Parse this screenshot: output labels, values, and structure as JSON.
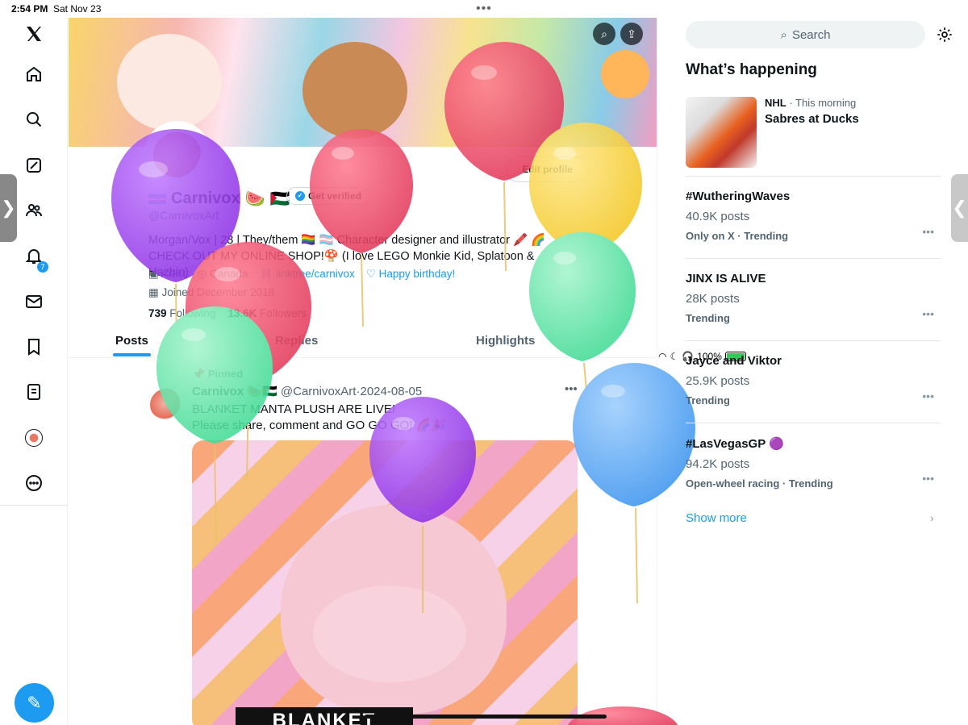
{
  "status": {
    "time": "2:54 PM",
    "date": "Sat Nov 23",
    "battery": "100%"
  },
  "nav": {
    "notifications_badge": "7"
  },
  "profile": {
    "name": "Carnivox",
    "handle": "@CarnivoxArt",
    "verified_label": "Get verified",
    "edit_label": "Edit profile",
    "bio_line1": "Morgan/Vox | 28 | They/them 🏳️‍🌈 🏳️‍⚧️ Character designer and illustrator 🖍️ 🌈",
    "bio_line2": "CHECK OUT MY ONLINE SHOP!🍄 (I love LEGO Monkie Kid, Splatoon & Hazbin)",
    "occupation": "Artist",
    "location": "Canada",
    "link": "linktree/carnivox",
    "birthday": "Happy birthday!",
    "joined": "Joined December 2018",
    "following_count": "739",
    "following_label": "Following",
    "followers_count": "13.6K",
    "followers_label": "Followers"
  },
  "tabs": [
    "Posts",
    "Replies",
    "Highlights"
  ],
  "post": {
    "pinned": "Pinned",
    "name": "Carnivox 🍉🇵🇸",
    "handle": "@CarnivoxArt",
    "date": "2024-08-05",
    "line1": "BLANKET MANTA PLUSH ARE LIVE!",
    "line2": "Please share, comment and GO GO GO! 🌈🎉",
    "image_label": "BLANKET"
  },
  "right": {
    "search_placeholder": "Search",
    "heading": "What’s happening",
    "news": {
      "source": "NHL",
      "when": "· This morning",
      "title": "Sabres at Ducks"
    },
    "trends": [
      {
        "title": "#WutheringWaves",
        "count": "40.9K posts",
        "sub": "Only on X · Trending"
      },
      {
        "title": "JINX IS ALIVE",
        "count": "28K posts",
        "sub": "Trending"
      },
      {
        "title": "Jayce and Viktor",
        "count": "25.9K posts",
        "sub": "Trending"
      },
      {
        "title": "#LasVegasGP 🟣",
        "count": "94.2K posts",
        "sub": "Open-wheel racing · Trending"
      }
    ],
    "show_more": "Show more"
  },
  "colors": {
    "accent": "#1d9bf0",
    "balloon_purple": "#9b3fe0",
    "balloon_red": "#e8425e",
    "balloon_yellow": "#f6d23c",
    "balloon_green": "#5ee3a5",
    "balloon_blue": "#4aa3f5"
  }
}
